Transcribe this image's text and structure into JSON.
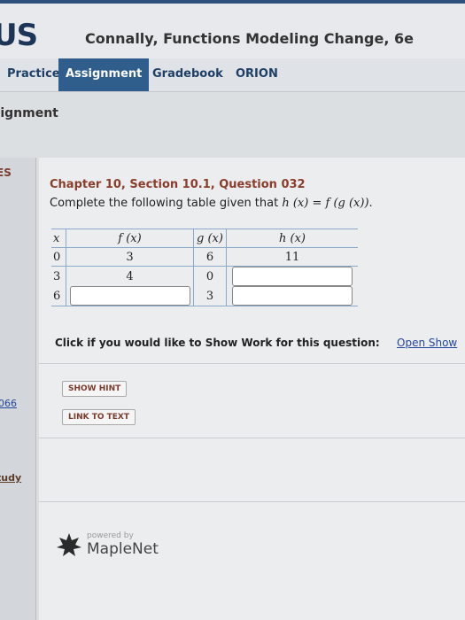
{
  "header": {
    "logo": "US",
    "course_title": "Connally, Functions Modeling Change, 6e"
  },
  "nav": {
    "tabs": [
      {
        "label": "Practice",
        "active": false
      },
      {
        "label": "Assignment",
        "active": true
      },
      {
        "label": "Gradebook",
        "active": false
      },
      {
        "label": "ORION",
        "active": false
      }
    ]
  },
  "section_title": "signment",
  "sidebar": {
    "label_es": "ES",
    "link": "066",
    "study": "tudy"
  },
  "question": {
    "title": "Chapter 10, Section 10.1, Question 032",
    "prompt": "Complete the following table given that",
    "formula": "h (x) = f (g (x))",
    "prompt_end": "."
  },
  "table": {
    "headers": [
      "x",
      "f (x)",
      "g (x)",
      "h (x)"
    ],
    "rows": [
      {
        "x": "0",
        "f": "3",
        "g": "6",
        "h": "11"
      },
      {
        "x": "3",
        "f": "4",
        "g": "0",
        "h": ""
      },
      {
        "x": "6",
        "f": "",
        "g": "3",
        "h": ""
      }
    ]
  },
  "show_work": {
    "text": "Click if you would like to Show Work for this question:",
    "link": "Open Show"
  },
  "buttons": {
    "hint": "SHOW HINT",
    "link_to_text": "LINK TO TEXT"
  },
  "footer": {
    "powered_by": "powered by",
    "brand": "MapleNet"
  }
}
